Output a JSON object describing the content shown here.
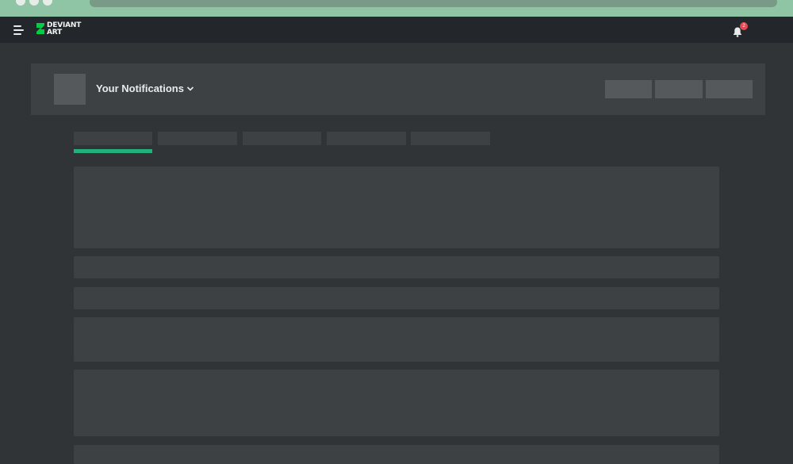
{
  "browser": {
    "window_controls": [
      "dot",
      "dot",
      "dot"
    ]
  },
  "topbar": {
    "menu_icon": "hamburger-menu-icon",
    "logo": {
      "line1": "DEVIANT",
      "line2": "ART",
      "color": "#05cc47"
    },
    "notifications_icon": "bell-icon",
    "notifications_count": "2"
  },
  "header": {
    "title": "Your Notifications",
    "dropdown_icon": "chevron-down-icon"
  },
  "tabs": {
    "active_index": 0,
    "accent_color": "#22b07b"
  },
  "colors": {
    "page_bg": "#313436",
    "topbar_bg": "#23262a",
    "chrome_bg": "#8fc4a5",
    "card_bg": "#3d4144",
    "placeholder": "#55595c",
    "badge": "#e34b54"
  }
}
